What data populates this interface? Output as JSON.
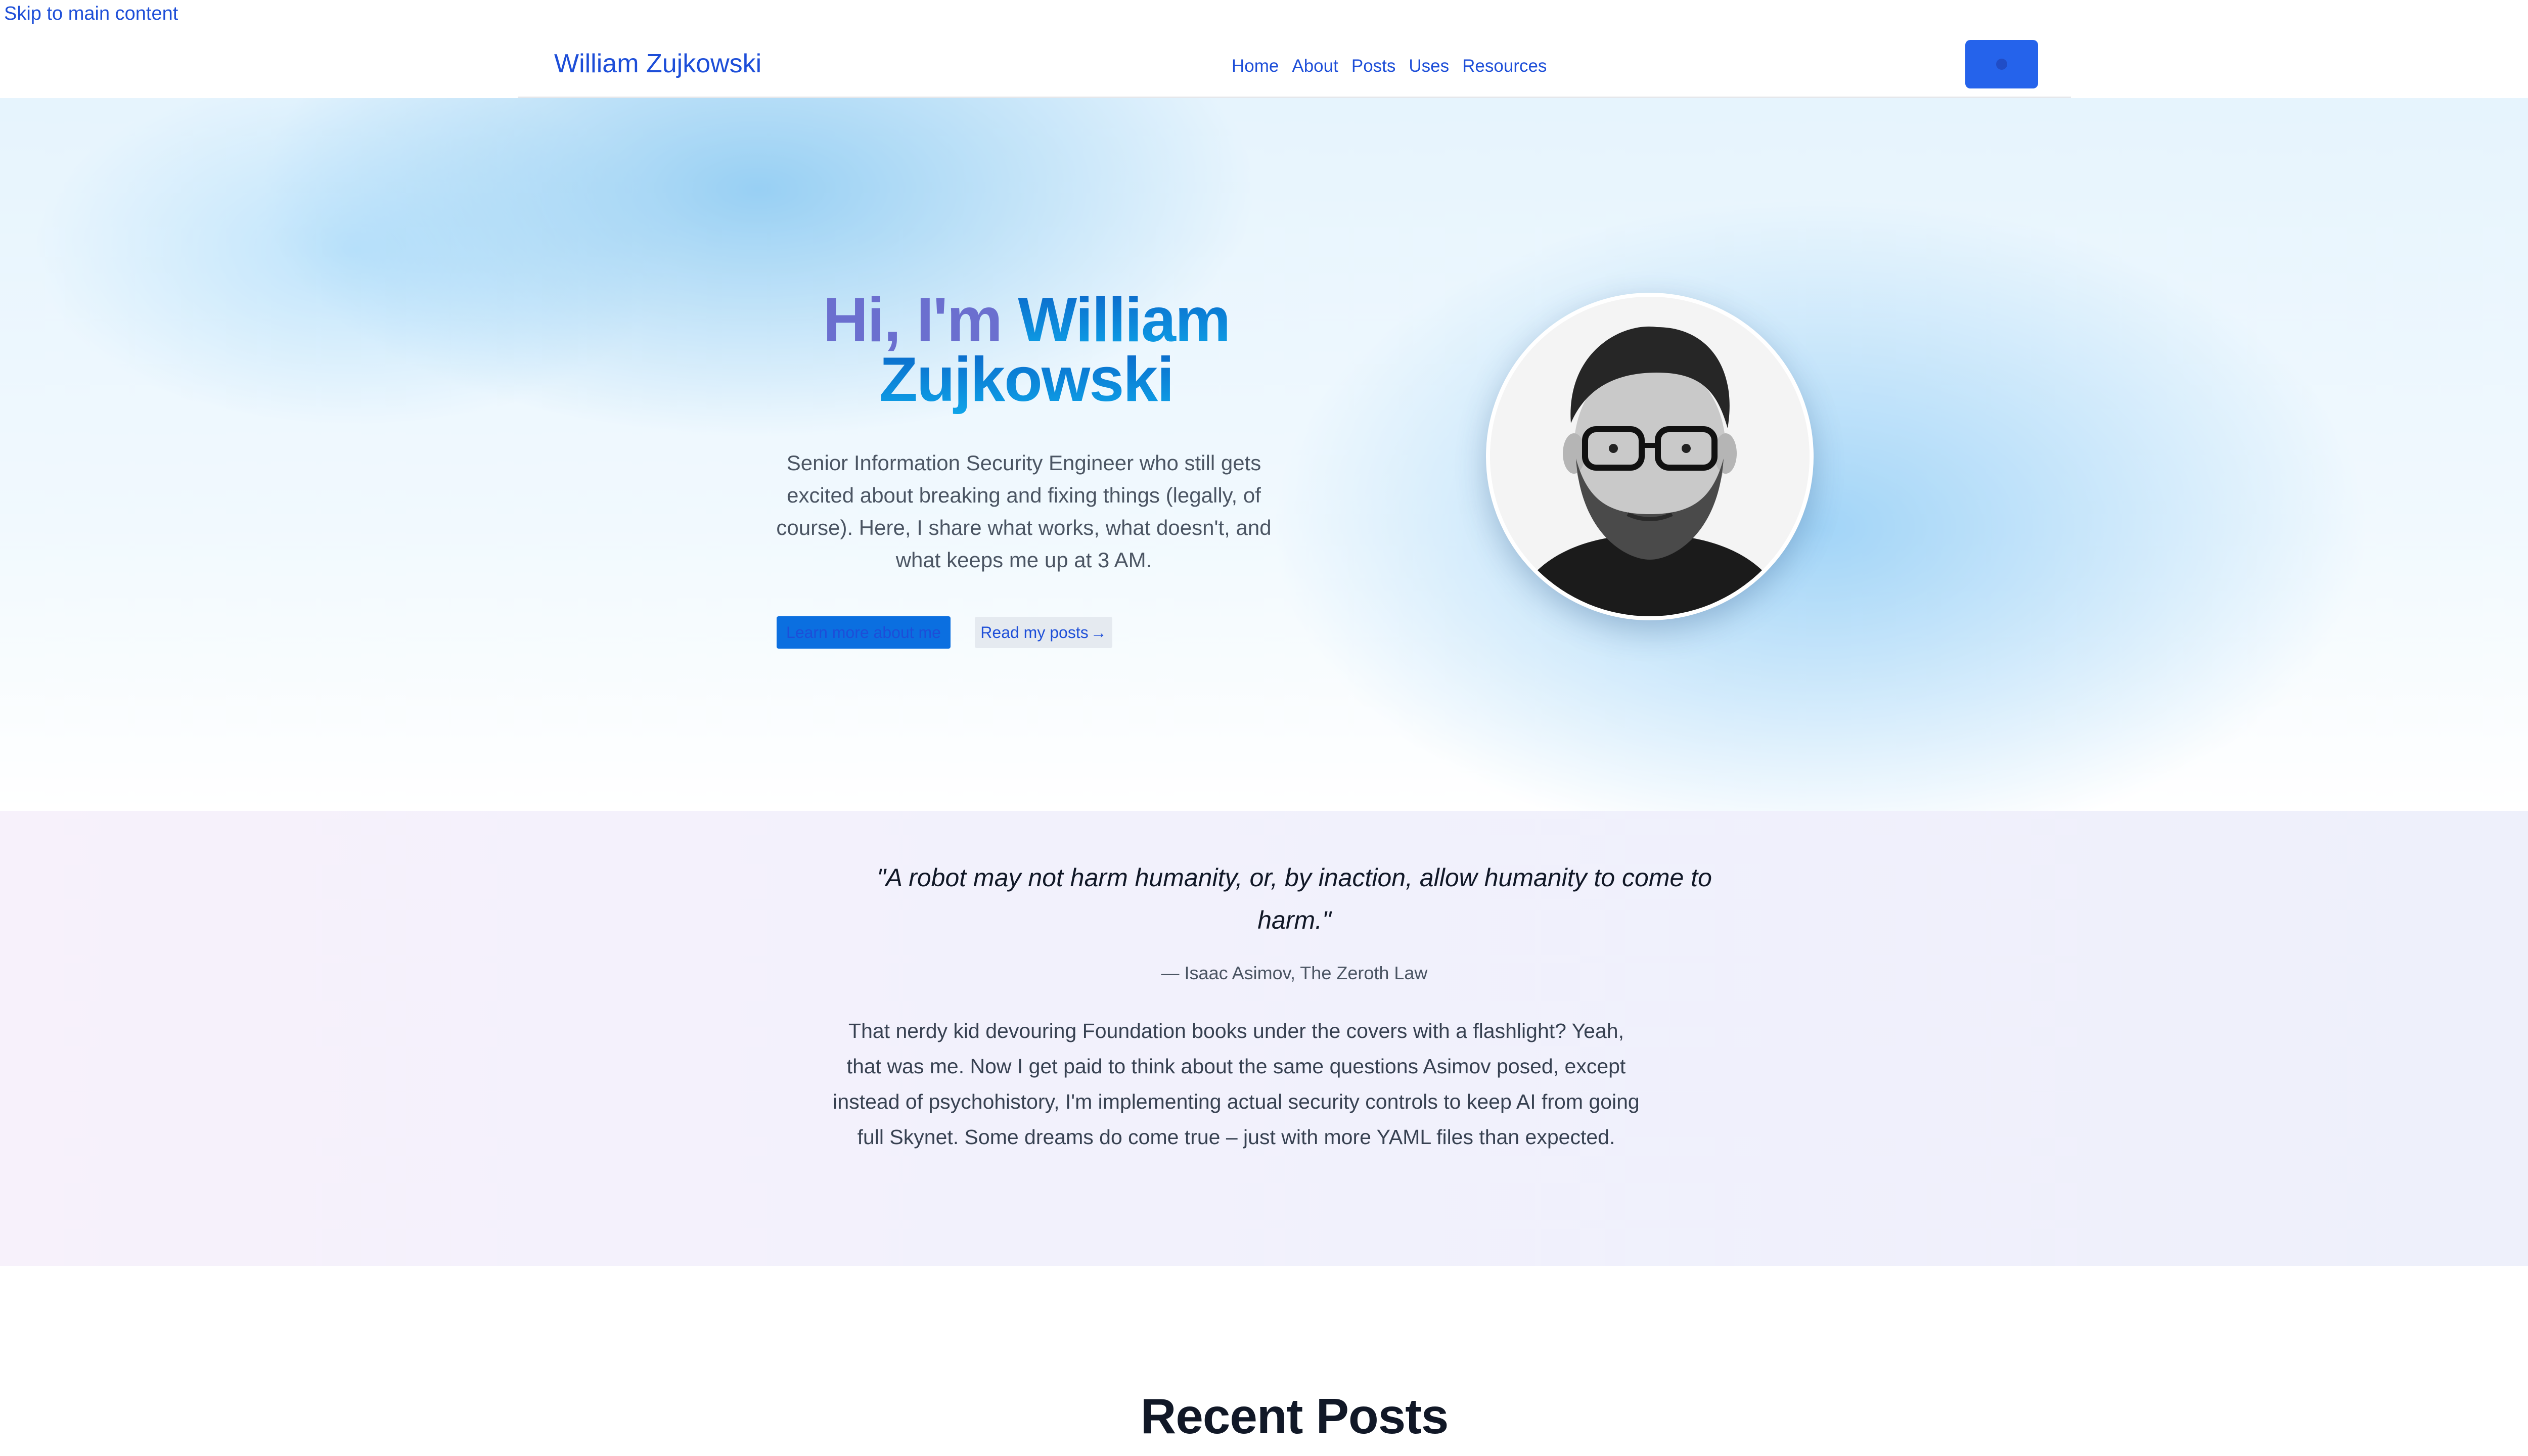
{
  "skip_link": "Skip to main content",
  "header": {
    "brand": "William Zujkowski",
    "nav": [
      "Home",
      "About",
      "Posts",
      "Uses",
      "Resources"
    ],
    "theme_toggle_icon": "sun-icon"
  },
  "hero": {
    "greeting": "Hi, I'm ",
    "name_line1": "William",
    "name_line2": "Zujkowski",
    "subtitle": "Senior Information Security Engineer who still gets excited about breaking and fixing things (legally, of course). Here, I share what works, what doesn't, and what keeps me up at 3 AM.",
    "primary_button": "Learn more about me",
    "secondary_button": "Read my posts",
    "secondary_arrow": "→"
  },
  "quote": {
    "text": "\"A robot may not harm humanity, or, by inaction, allow humanity to come to harm.\"",
    "attribution": "— Isaac Asimov, The Zeroth Law",
    "body": "That nerdy kid devouring Foundation books under the covers with a flashlight? Yeah, that was me. Now I get paid to think about the same questions Asimov posed, except instead of psychohistory, I'm implementing actual security controls to keep AI from going full Skynet. Some dreams do come true – just with more YAML files than expected."
  },
  "recent_posts": {
    "heading": "Recent Posts"
  },
  "colors": {
    "link": "#1d4ed8",
    "accent": "#2563eb",
    "greeting": "#6b6fcf"
  }
}
